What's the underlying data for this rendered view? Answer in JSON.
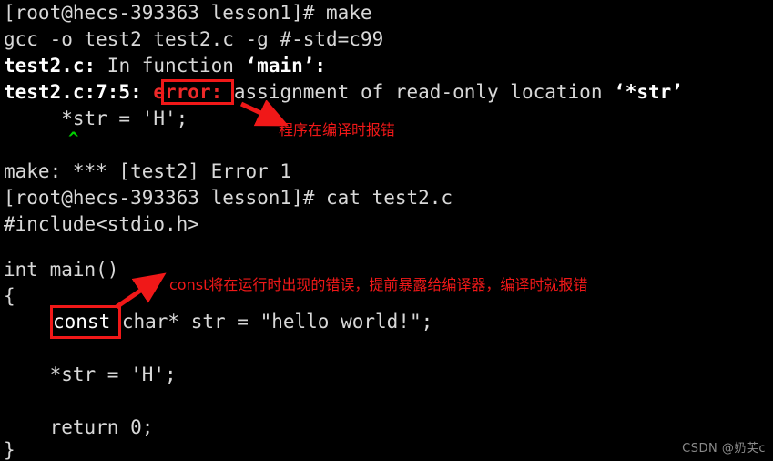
{
  "terminal": {
    "background_color": "#000000",
    "foreground_color": "#e8e8e8",
    "lines": [
      {
        "id": "prompt-make",
        "text": "[root@hecs-393363 lesson1]# make"
      },
      {
        "id": "gcc-command",
        "text": "gcc -o test2 test2.c -g #-std=c99"
      },
      {
        "id": "in-function-pre",
        "text": "test2.c:"
      },
      {
        "id": "in-function-mid",
        "text": " In function "
      },
      {
        "id": "in-function-name",
        "text": "‘main’:"
      },
      {
        "id": "error-loc",
        "text": "test2.c:7:5:"
      },
      {
        "id": "error-keyword",
        "text": "error:"
      },
      {
        "id": "error-msg",
        "text": " assignment of read-only location "
      },
      {
        "id": "error-symbol",
        "text": "‘*str’"
      },
      {
        "id": "error-src",
        "text": "     *str = 'H';"
      },
      {
        "id": "error-caret",
        "text": "^"
      },
      {
        "id": "make-error",
        "text": "make: *** [test2] Error 1"
      },
      {
        "id": "prompt-cat",
        "text": "[root@hecs-393363 lesson1]# cat test2.c"
      },
      {
        "id": "src-include",
        "text": "#include<stdio.h>"
      },
      {
        "id": "src-main",
        "text": "int main()"
      },
      {
        "id": "src-open-brace",
        "text": "{"
      },
      {
        "id": "src-const-word",
        "text": "const"
      },
      {
        "id": "src-decl-rest",
        "text": " char* str = \"hello world!\";"
      },
      {
        "id": "src-assign",
        "text": "    *str = 'H';"
      },
      {
        "id": "src-return",
        "text": "    return 0;"
      },
      {
        "id": "src-close-brace",
        "text": "}"
      }
    ]
  },
  "annotations": {
    "color": "#f01818",
    "error_note": "程序在编译时报错",
    "const_note": "const将在运行时出现的错误，提前暴露给编译器，编译时就报错"
  },
  "watermark": {
    "text": "CSDN @奶芙c"
  }
}
